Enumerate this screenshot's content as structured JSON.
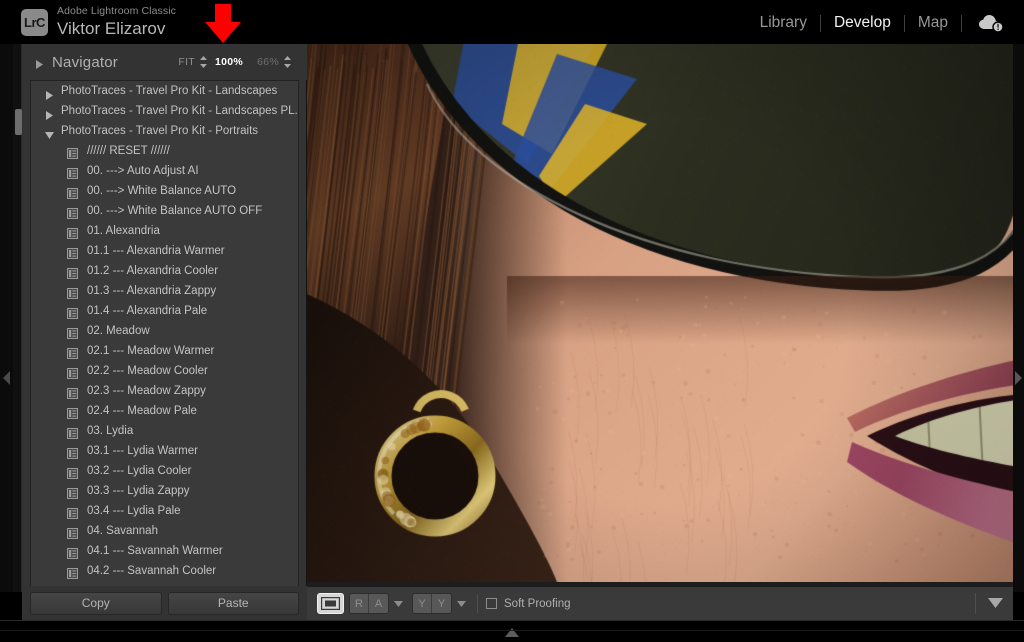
{
  "identity": {
    "logo_text": "LrC",
    "app_name": "Adobe Lightroom Classic",
    "user_name": "Viktor Elizarov"
  },
  "modules": {
    "items": [
      {
        "label": "Library",
        "active": false
      },
      {
        "label": "Develop",
        "active": true
      },
      {
        "label": "Map",
        "active": false
      }
    ],
    "cloud_icon": "cloud-sync-alert-icon"
  },
  "annotation": {
    "arrow_color": "#FF0000",
    "arrow_icon": "red-down-arrow",
    "points_at": "100%"
  },
  "navigator": {
    "title": "Navigator",
    "expand_icon": "triangle-right-icon",
    "fit_label": "FIT",
    "zoom_active": "100%",
    "zoom_secondary": "66%",
    "stepper_icon": "up-down-stepper-icon"
  },
  "presets": {
    "groups": [
      {
        "label": "PhotoTraces - Travel Pro Kit - Landscapes",
        "expanded": false
      },
      {
        "label": "PhotoTraces - Travel Pro Kit - Landscapes PL...",
        "expanded": false
      },
      {
        "label": "PhotoTraces - Travel Pro Kit - Portraits",
        "expanded": true
      }
    ],
    "items": [
      "////// RESET //////",
      "00. ---> Auto Adjust AI",
      "00. ---> White Balance AUTO",
      "00. ---> White Balance AUTO OFF",
      "01. Alexandria",
      "01.1 --- Alexandria  Warmer",
      "01.2 --- Alexandria Cooler",
      "01.3 --- Alexandria  Zappy",
      "01.4 --- Alexandria  Pale",
      "02. Meadow",
      "02.1 --- Meadow Warmer",
      "02.2 --- Meadow Cooler",
      "02.3 --- Meadow Zappy",
      "02.4 --- Meadow Pale",
      "03. Lydia",
      "03.1 --- Lydia Warmer",
      "03.2 --- Lydia Cooler",
      "03.3 --- Lydia Zappy",
      "03.4 --- Lydia Pale",
      "04. Savannah",
      "04.1 --- Savannah Warmer",
      "04.2 --- Savannah Cooler"
    ],
    "item_icon": "preset-list-icon"
  },
  "panel_buttons": {
    "copy_label": "Copy",
    "paste_label": "Paste"
  },
  "toolbar": {
    "loupe_icon": "loupe-view-icon",
    "before_after_ra": [
      "R",
      "A"
    ],
    "before_after_yy": [
      "Y",
      "Y"
    ],
    "caret_icon": "caret-down-icon",
    "soft_proofing_label": "Soft Proofing",
    "soft_proofing_checked": false,
    "overflow_icon": "triangle-down-icon"
  },
  "edges": {
    "left_collapse_icon": "triangle-left-icon",
    "right_collapse_icon": "triangle-right-icon",
    "bottom_collapse_icon": "triangle-up-icon"
  },
  "photo": {
    "description": "Close-up portrait of a woman wearing dark sunglasses and a gold hoop earring, smiling",
    "zoom_level": "100%",
    "colors": {
      "skin": "#d8a184",
      "skin_shadow": "#b07b5e",
      "hair": "#2b1a13",
      "hair_light": "#6b4128",
      "lens": "#2c2e20",
      "frame": "#121210",
      "reflection_blue": "#2b4f9e",
      "reflection_yellow": "#e0b427",
      "gold": "#c8a13c",
      "gold_light": "#efe0a8",
      "teeth": "#e8e6c4",
      "lip": "#c2728c",
      "lip_dark": "#8e3a56",
      "mouth_dark": "#2a1016",
      "background_dark": "#14100e"
    }
  }
}
